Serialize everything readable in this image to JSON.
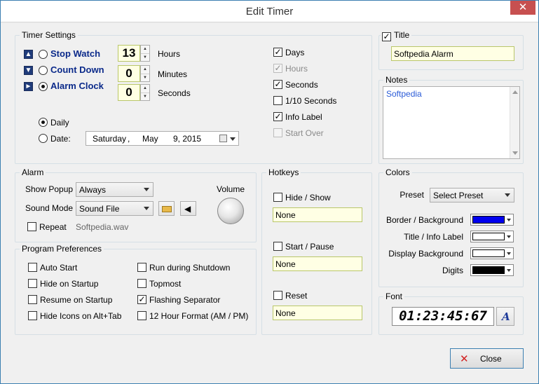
{
  "window": {
    "title": "Edit Timer",
    "close_glyph": "✕"
  },
  "timer_settings": {
    "legend": "Timer Settings",
    "modes": [
      {
        "label": "Stop Watch",
        "selected": false,
        "icon": "arrow-up-icon"
      },
      {
        "label": "Count Down",
        "selected": false,
        "icon": "arrow-down-icon"
      },
      {
        "label": "Alarm Clock",
        "selected": true,
        "icon": "arrow-right-icon"
      }
    ],
    "hours": {
      "value": "13",
      "label": "Hours"
    },
    "minutes": {
      "value": "0",
      "label": "Minutes"
    },
    "seconds": {
      "value": "0",
      "label": "Seconds"
    },
    "daily_label": "Daily",
    "date_label": "Date:",
    "date": {
      "weekday": "Saturday",
      "sep": ",",
      "month": "May",
      "day_year": "9, 2015"
    },
    "display_options": [
      {
        "label": "Days",
        "checked": true,
        "enabled": true
      },
      {
        "label": "Hours",
        "checked": true,
        "enabled": false
      },
      {
        "label": "Seconds",
        "checked": true,
        "enabled": true
      },
      {
        "label": "1/10 Seconds",
        "checked": false,
        "enabled": true
      },
      {
        "label": "Info Label",
        "checked": true,
        "enabled": true
      },
      {
        "label": "Start Over",
        "checked": false,
        "enabled": false
      }
    ]
  },
  "title_group": {
    "label": "Title",
    "checked": true,
    "value": "Softpedia Alarm"
  },
  "notes_group": {
    "legend": "Notes",
    "value": "Softpedia"
  },
  "alarm": {
    "legend": "Alarm",
    "show_popup_label": "Show Popup",
    "show_popup_value": "Always",
    "sound_mode_label": "Sound Mode",
    "sound_mode_value": "Sound File",
    "volume_label": "Volume",
    "repeat_label": "Repeat",
    "repeat_checked": false,
    "sound_file": "Softpedia.wav"
  },
  "program_preferences": {
    "legend": "Program Preferences",
    "left": [
      {
        "label": "Auto Start",
        "checked": false
      },
      {
        "label": "Hide on Startup",
        "checked": false
      },
      {
        "label": "Resume on Startup",
        "checked": false
      },
      {
        "label": "Hide Icons on Alt+Tab",
        "checked": false
      }
    ],
    "right": [
      {
        "label": "Run during Shutdown",
        "checked": false
      },
      {
        "label": "Topmost",
        "checked": false
      },
      {
        "label": "Flashing Separator",
        "checked": true
      },
      {
        "label": "12 Hour Format (AM / PM)",
        "checked": false
      }
    ]
  },
  "hotkeys": {
    "legend": "Hotkeys",
    "items": [
      {
        "label": "Hide / Show",
        "checked": false,
        "value": "None"
      },
      {
        "label": "Start / Pause",
        "checked": false,
        "value": "None"
      },
      {
        "label": "Reset",
        "checked": false,
        "value": "None"
      }
    ]
  },
  "colors": {
    "legend": "Colors",
    "preset_label": "Preset",
    "preset_value": "Select Preset",
    "rows": [
      {
        "label": "Border / Background",
        "color": "#0000ee"
      },
      {
        "label": "Title / Info Label",
        "color": "#ffffff"
      },
      {
        "label": "Display Background",
        "color": "#ffffff"
      },
      {
        "label": "Digits",
        "color": "#000000"
      }
    ]
  },
  "font": {
    "legend": "Font",
    "preview": "01:23:45:67",
    "button_glyph": "A"
  },
  "close_button": {
    "label": "Close",
    "glyph": "✕"
  }
}
